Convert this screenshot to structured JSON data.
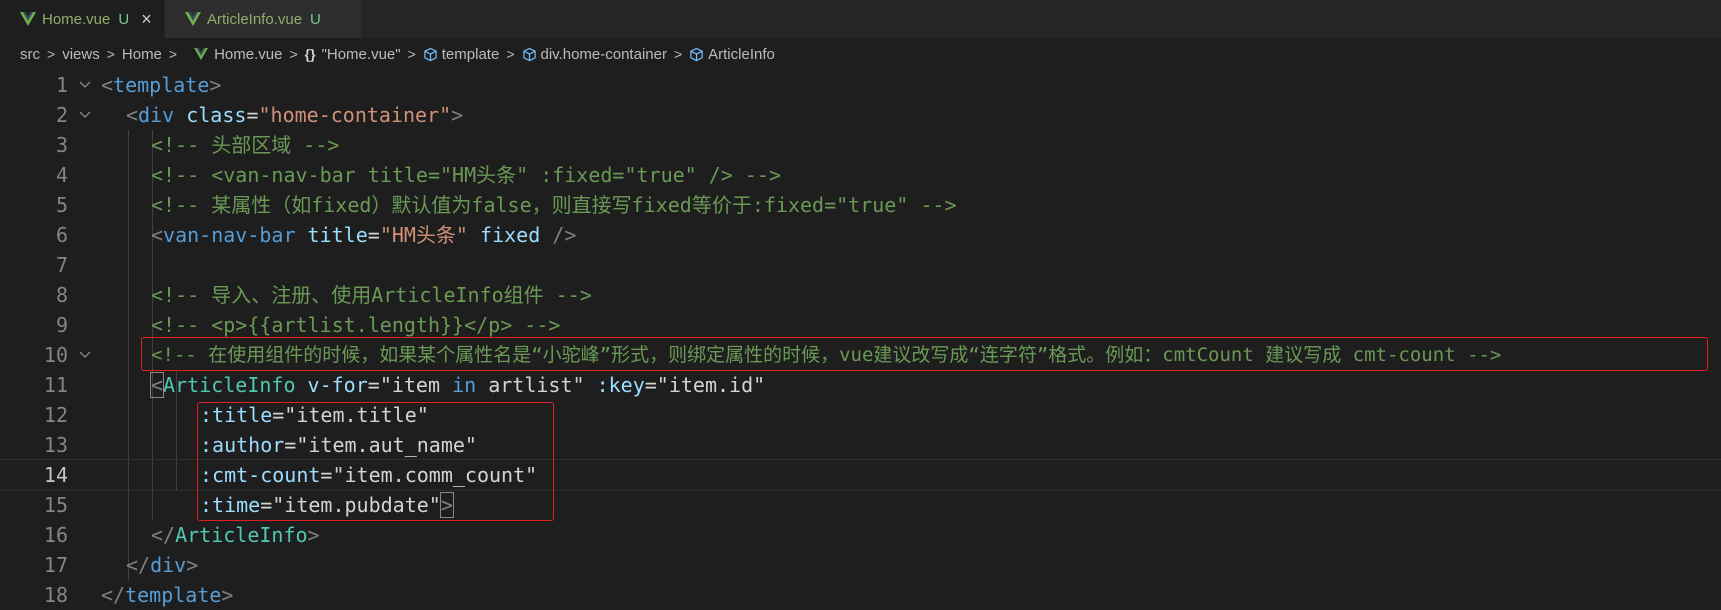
{
  "tabs": [
    {
      "label": "Home.vue",
      "status": "U",
      "active": true,
      "close_icon": "×"
    },
    {
      "label": "ArticleInfo.vue",
      "status": "U",
      "active": false
    }
  ],
  "breadcrumb": {
    "items": [
      "src",
      "views",
      "Home",
      "Home.vue",
      "\"Home.vue\"",
      "template",
      "div.home-container",
      "ArticleInfo"
    ],
    "separator": ">",
    "curly": "{}"
  },
  "code_lines": [
    {
      "n": "1"
    },
    {
      "n": "2"
    },
    {
      "n": "3"
    },
    {
      "n": "4"
    },
    {
      "n": "5"
    },
    {
      "n": "6"
    },
    {
      "n": "7"
    },
    {
      "n": "8"
    },
    {
      "n": "9"
    },
    {
      "n": "10"
    },
    {
      "n": "11"
    },
    {
      "n": "12"
    },
    {
      "n": "13"
    },
    {
      "n": "14"
    },
    {
      "n": "15"
    },
    {
      "n": "16"
    },
    {
      "n": "17"
    },
    {
      "n": "18"
    }
  ],
  "code": {
    "l1_tag": "template",
    "l2_tag": "div",
    "l2_attr": "class",
    "l2_val": "\"home-container\"",
    "l3": "<!-- 头部区域 -->",
    "l4": "<!-- <van-nav-bar title=\"HM头条\" :fixed=\"true\" /> -->",
    "l5": "<!-- 某属性（如fixed）默认值为false，则直接写fixed等价于:fixed=\"true\" -->",
    "l6_tag": "van-nav-bar",
    "l6_attr1": "title",
    "l6_val1": "\"HM头条\"",
    "l6_attr2": "fixed",
    "l8": "<!-- 导入、注册、使用ArticleInfo组件 -->",
    "l9": "<!-- <p>{{artlist.length}}</p> -->",
    "l10": "<!-- 在使用组件的时候，如果某个属性名是“小驼峰”形式，则绑定属性的时候，vue建议改写成“连字符”格式。例如：cmtCount 建议写成 cmt-count -->",
    "l11_tag": "ArticleInfo",
    "l11_attr1": "v-for",
    "l11_v1a": "\"item ",
    "l11_v1kw": "in",
    "l11_v1b": " artlist\"",
    "l11_attr2": ":key",
    "l11_val2": "\"item.id\"",
    "l12_attr": ":title",
    "l12_val": "\"item.title\"",
    "l13_attr": ":author",
    "l13_val": "\"item.aut_name\"",
    "l14_attr": ":cmt-count",
    "l14_val": "\"item.comm_count\"",
    "l15_attr": ":time",
    "l15_val": "\"item.pubdate\"",
    "l16_tag": "ArticleInfo",
    "l17_tag": "div",
    "l18_tag": "template"
  },
  "colors": {
    "background": "#1e1e1e",
    "tag": "#569cd6",
    "component": "#4ec9b0",
    "attribute": "#9cdcfe",
    "string": "#ce9178",
    "comment": "#6a9955",
    "highlight_box": "#e02020"
  },
  "icons": {
    "file": "vue-icon",
    "symbol": "cube-icon",
    "fold": "chevron-down-icon"
  }
}
